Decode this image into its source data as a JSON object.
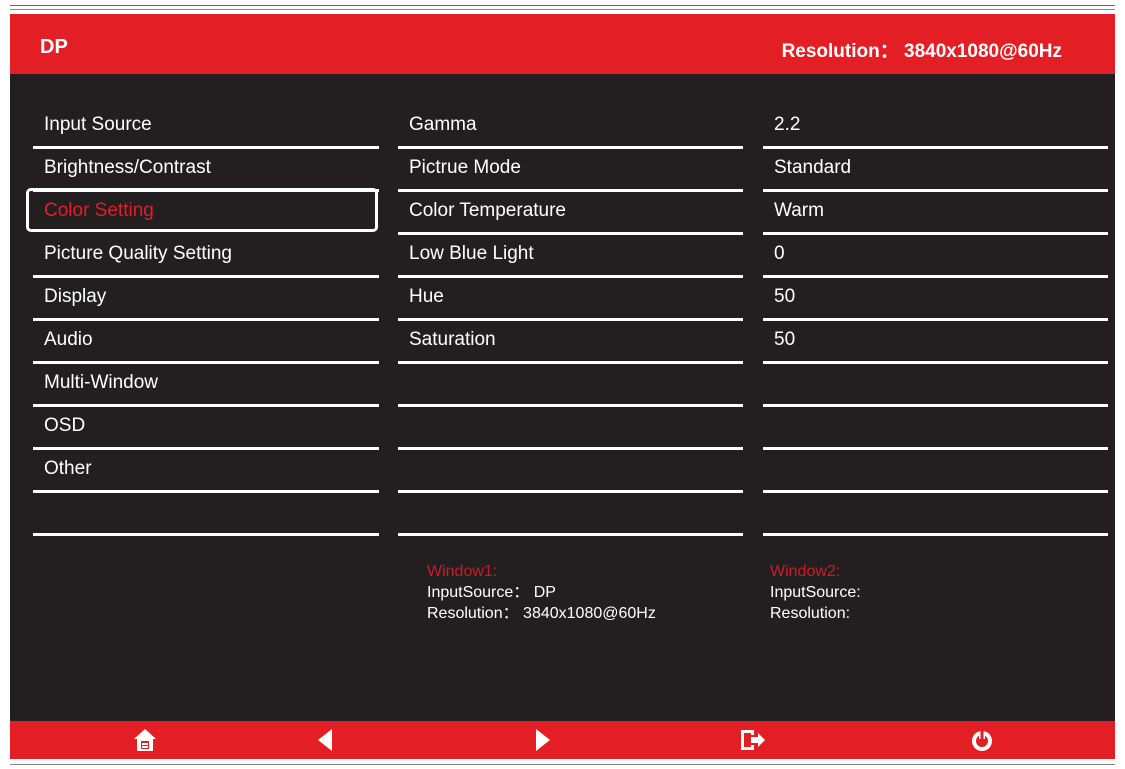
{
  "header": {
    "source": "DP",
    "resolution": "Resolution：  3840x1080@60Hz"
  },
  "menu": {
    "selected_index": 2,
    "items": [
      {
        "label": "Input Source"
      },
      {
        "label": "Brightness/Contrast"
      },
      {
        "label": "Color Setting"
      },
      {
        "label": "Picture Quality Setting"
      },
      {
        "label": "Display"
      },
      {
        "label": "Audio"
      },
      {
        "label": "Multi-Window"
      },
      {
        "label": "OSD"
      },
      {
        "label": "Other"
      },
      {
        "label": ""
      }
    ]
  },
  "settings": [
    {
      "name": "Gamma",
      "value": "2.2"
    },
    {
      "name": "Pictrue Mode",
      "value": "Standard"
    },
    {
      "name": "Color Temperature",
      "value": "Warm"
    },
    {
      "name": "Low Blue Light",
      "value": "0"
    },
    {
      "name": "Hue",
      "value": "50"
    },
    {
      "name": "Saturation",
      "value": "50"
    },
    {
      "name": "",
      "value": ""
    },
    {
      "name": "",
      "value": ""
    },
    {
      "name": "",
      "value": ""
    },
    {
      "name": "",
      "value": ""
    }
  ],
  "window1": {
    "title": "Window1:",
    "input_source": "InputSource：  DP",
    "resolution": "Resolution：  3840x1080@60Hz"
  },
  "window2": {
    "title": "Window2:",
    "input_source": "InputSource:",
    "resolution": "Resolution:"
  },
  "footer": {
    "buttons": [
      {
        "icon": "home-icon"
      },
      {
        "icon": "arrow-left-icon"
      },
      {
        "icon": "arrow-right-icon"
      },
      {
        "icon": "exit-icon"
      },
      {
        "icon": "power-icon"
      }
    ]
  },
  "colors": {
    "accent": "#e31e24",
    "background": "#231f20",
    "text": "#ffffff"
  }
}
